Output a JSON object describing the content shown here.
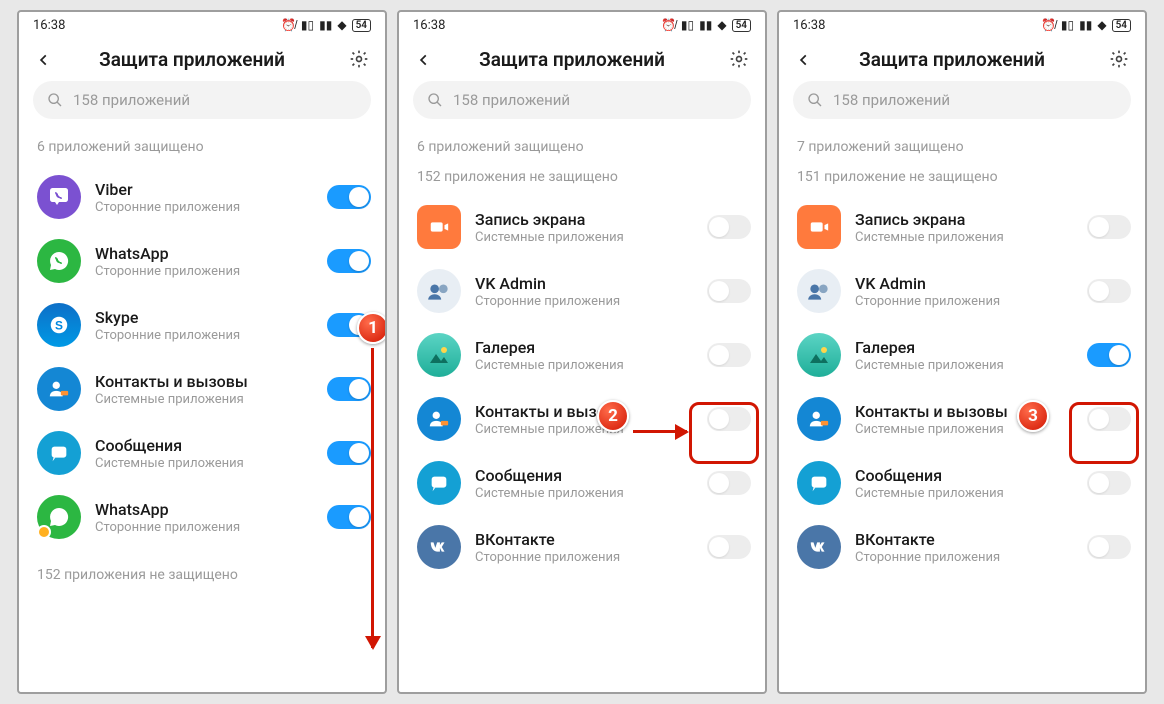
{
  "status": {
    "time": "16:38",
    "battery": "54"
  },
  "header": {
    "title": "Защита приложений"
  },
  "search": {
    "placeholder": "158 приложений"
  },
  "labels": {
    "protected6": "6 приложений защищено",
    "protected7": "7 приложений защищено",
    "unprotected152": "152 приложения не защищено",
    "unprotected151": "151 приложение не защищено",
    "third_party": "Сторонние приложения",
    "system": "Системные приложения"
  },
  "apps": {
    "viber": "Viber",
    "whatsapp": "WhatsApp",
    "skype": "Skype",
    "contacts": "Контакты и вызовы",
    "messages": "Сообщения",
    "screenrec": "Запись экрана",
    "vkadmin": "VK Admin",
    "gallery": "Галерея",
    "vkontakte": "ВКонтакте"
  },
  "badges": {
    "b1": "1",
    "b2": "2",
    "b3": "3"
  }
}
